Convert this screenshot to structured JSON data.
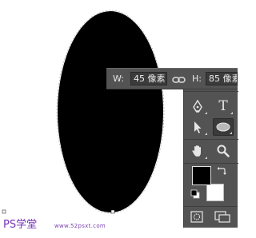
{
  "size_readout": {
    "width_label": "W:",
    "width_value": "45 像素",
    "height_label": "H:",
    "height_value": "85 像素",
    "link_icon": "chain-link-icon"
  },
  "toolbar": {
    "tools": [
      {
        "name": "pen-tool",
        "icon": "pen-icon"
      },
      {
        "name": "type-tool",
        "icon": "type-icon",
        "glyph": "T"
      },
      {
        "name": "path-selection-tool",
        "icon": "arrow-icon"
      },
      {
        "name": "ellipse-tool",
        "icon": "ellipse-icon",
        "selected": true
      },
      {
        "name": "hand-tool",
        "icon": "hand-icon"
      },
      {
        "name": "zoom-tool",
        "icon": "magnifier-icon"
      }
    ],
    "foreground_color": "#000000",
    "background_color": "#ffffff"
  },
  "watermark": {
    "left_text": "PS学堂",
    "right_text": "www.52psxt.com"
  },
  "colors": {
    "panel": "#535353",
    "field": "#3b3b3b",
    "shape_fill": "#000000",
    "watermark": "#7a3fb0"
  }
}
